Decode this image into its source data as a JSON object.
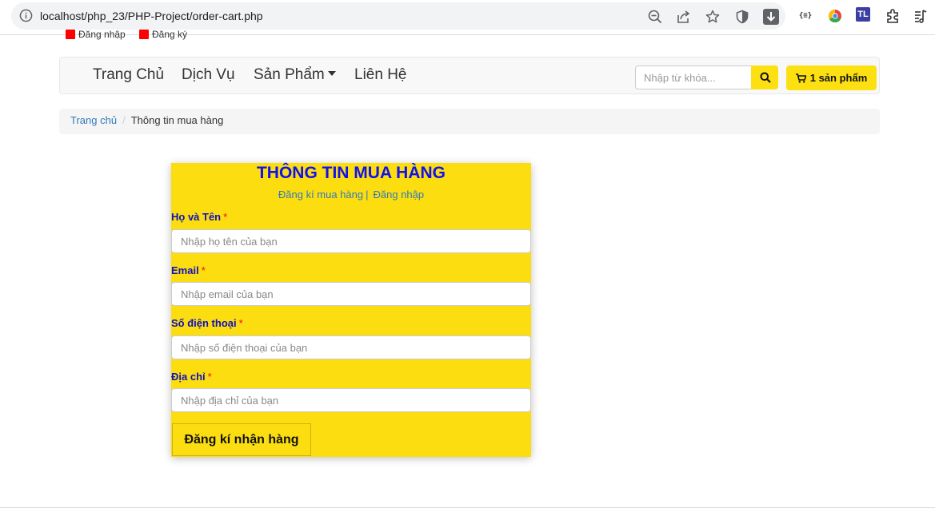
{
  "browser": {
    "url": "localhost/php_23/PHP-Project/order-cart.php",
    "extensions": [
      "zoom-out-icon",
      "share-icon",
      "star-icon",
      "shield-icon",
      "download-icon",
      "braces-extension-icon",
      "chrome-color-icon",
      "tl-extension-icon",
      "puzzle-icon",
      "reading-list-icon"
    ],
    "braces_text": "{≡}",
    "tl_text": "TL"
  },
  "top_links": {
    "login": "Đăng nhập",
    "register": "Đăng ký"
  },
  "navbar": {
    "items": [
      {
        "label": "Trang Chủ"
      },
      {
        "label": "Dịch Vụ"
      },
      {
        "label": "Sản Phẩm"
      },
      {
        "label": "Liên Hệ"
      }
    ],
    "search_placeholder": "Nhập từ khóa...",
    "cart_label": "1 sản phẩm"
  },
  "breadcrumb": {
    "home": "Trang chủ",
    "separator": "/",
    "current": "Thông tin mua hàng"
  },
  "form": {
    "title": "THÔNG TIN MUA HÀNG",
    "register_link": "Đăng kí mua hàng",
    "divider": "|",
    "login_link": "Đăng nhập",
    "required_mark": "*",
    "fields": [
      {
        "label": "Họ và Tên",
        "placeholder": "Nhập họ tên của bạn",
        "value": ""
      },
      {
        "label": "Email",
        "placeholder": "Nhập email của bạn",
        "value": ""
      },
      {
        "label": "Số điện thoại",
        "placeholder": "Nhập số điện thoại của bạn",
        "value": ""
      },
      {
        "label": "Địa chỉ",
        "placeholder": "Nhập địa chỉ của bạn",
        "value": ""
      }
    ],
    "submit_label": "Đăng kí nhận hàng"
  },
  "colors": {
    "accent_yellow": "#fbdd10",
    "title_blue": "#1010f0",
    "link_blue": "#337ab7",
    "required_red": "#ff0000"
  }
}
